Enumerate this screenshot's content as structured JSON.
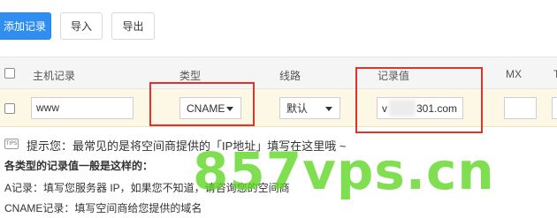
{
  "toolbar": {
    "add_label": "添加记录",
    "import_label": "导入",
    "export_label": "导出"
  },
  "table": {
    "headers": {
      "host": "主机记录",
      "type": "类型",
      "line": "线路",
      "value": "记录值",
      "mx": "MX",
      "ttl": "T"
    },
    "row": {
      "host": "www",
      "type": "CNAME",
      "line": "默认",
      "value_prefix": "v",
      "value_suffix": "301.com",
      "mx": ""
    }
  },
  "tips": {
    "main": "提示您：最常见的是将空间商提供的「IP地址」填写在这里哦 ~",
    "subhead": "各类型的记录值一般是这样的：",
    "a_record": "A记录：填写您服务器 IP，如果您不知道，请咨询您的空间商",
    "cname_record": "CNAME记录：填写空间商给您提供的域名"
  },
  "watermark": "857vps.cn",
  "colors": {
    "primary": "#2f8ef0",
    "highlight": "#e0332c",
    "row_bg": "#fdf7e6",
    "watermark": "#5cd620"
  }
}
